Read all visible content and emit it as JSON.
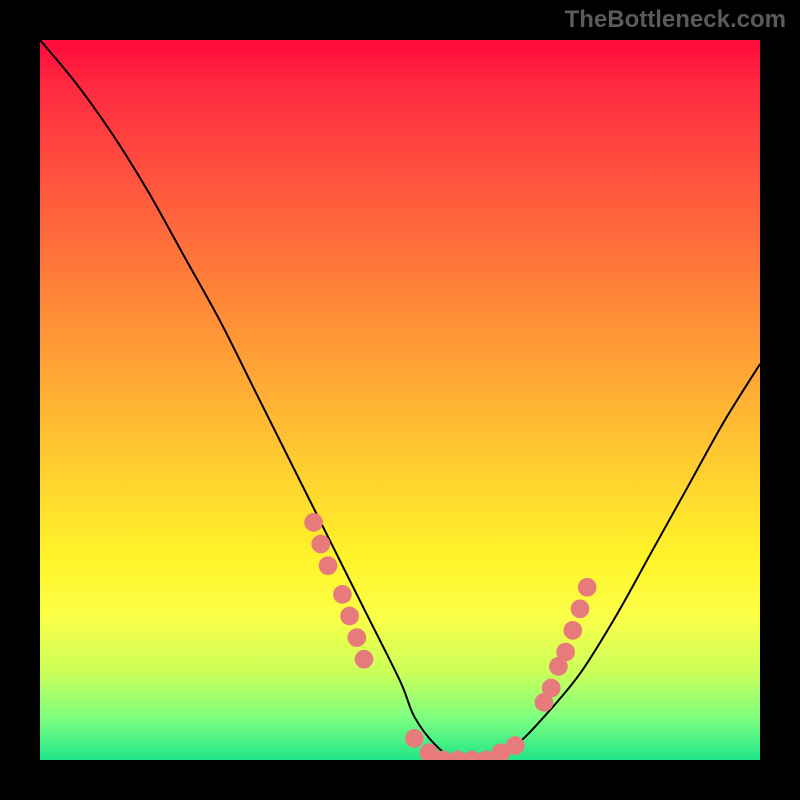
{
  "watermark": "TheBottleneck.com",
  "chart_data": {
    "type": "line",
    "title": "",
    "xlabel": "",
    "ylabel": "",
    "xlim": [
      0,
      100
    ],
    "ylim": [
      0,
      100
    ],
    "grid": false,
    "series": [
      {
        "name": "curve",
        "x": [
          0,
          5,
          10,
          15,
          20,
          25,
          30,
          35,
          40,
          45,
          50,
          52,
          55,
          58,
          62,
          66,
          70,
          75,
          80,
          85,
          90,
          95,
          100
        ],
        "y": [
          100,
          94,
          87,
          79,
          70,
          61,
          51,
          41,
          31,
          21,
          11,
          6,
          2,
          0,
          0,
          2,
          6,
          12,
          20,
          29,
          38,
          47,
          55
        ],
        "color": "#000000"
      }
    ],
    "dot_series": [
      {
        "name": "left-cluster",
        "color": "#e77a7a",
        "points": [
          {
            "x": 38,
            "y": 33
          },
          {
            "x": 39,
            "y": 30
          },
          {
            "x": 40,
            "y": 27
          },
          {
            "x": 42,
            "y": 23
          },
          {
            "x": 43,
            "y": 20
          },
          {
            "x": 44,
            "y": 17
          },
          {
            "x": 45,
            "y": 14
          }
        ]
      },
      {
        "name": "bottom-cluster",
        "color": "#e77a7a",
        "points": [
          {
            "x": 52,
            "y": 3
          },
          {
            "x": 54,
            "y": 1
          },
          {
            "x": 56,
            "y": 0
          },
          {
            "x": 58,
            "y": 0
          },
          {
            "x": 60,
            "y": 0
          },
          {
            "x": 62,
            "y": 0
          },
          {
            "x": 64,
            "y": 1
          },
          {
            "x": 66,
            "y": 2
          }
        ]
      },
      {
        "name": "right-cluster",
        "color": "#e77a7a",
        "points": [
          {
            "x": 70,
            "y": 8
          },
          {
            "x": 71,
            "y": 10
          },
          {
            "x": 72,
            "y": 13
          },
          {
            "x": 73,
            "y": 15
          },
          {
            "x": 74,
            "y": 18
          },
          {
            "x": 75,
            "y": 21
          },
          {
            "x": 76,
            "y": 24
          }
        ]
      }
    ]
  }
}
